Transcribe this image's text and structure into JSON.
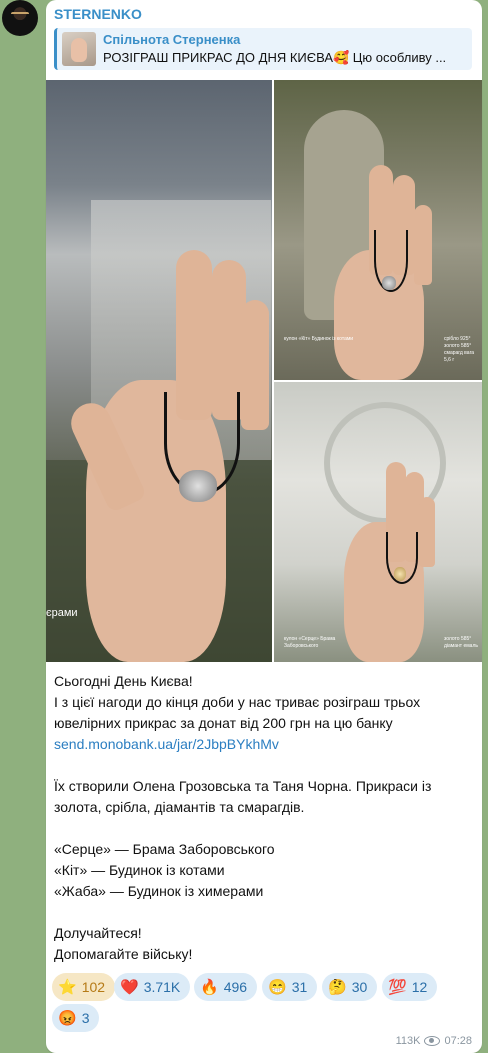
{
  "channel": {
    "name": "STERNENKO"
  },
  "reply": {
    "author": "Спільнота Стерненка",
    "preview": "РОЗІГРАШ ПРИКРАС ДО ДНЯ КИЄВА🥰 Цю особливу ..."
  },
  "photos": {
    "p1_caption": "єрами",
    "p2_caption_left": "кулон «Кіт» Будинок із котами",
    "p2_caption_right": "срібло 925° золото 585° смарагд вага 5,6 г",
    "p3_caption_left": "кулон «Серце» Брама Заборовського",
    "p3_caption_right": "золото 585° діамант емаль"
  },
  "message": {
    "line1": "Сьогодні День Києва!",
    "line2": "І з цієї нагоди до кінця доби у нас триває розіграш трьох ювелірних прикрас за донат від 200 грн на цю банку",
    "link": "send.monobank.ua/jar/2JbpBYkhMv",
    "line3": "Їх створили Олена Грозовська та Таня Чорна. Прикраси із золота, срібла, діамантів та смарагдів.",
    "item1": "«Серце» — Брама Заборовського",
    "item2": "«Кіт» — Будинок із котами",
    "item3": "«Жаба» — Будинок із химерами",
    "closing1": "Долучайтеся!",
    "closing2": "Допомагайте війську!"
  },
  "reactions": [
    {
      "emoji": "⭐",
      "count": "102"
    },
    {
      "emoji": "❤️",
      "count": "3.71K"
    },
    {
      "emoji": "🔥",
      "count": "496"
    },
    {
      "emoji": "😁",
      "count": "31"
    },
    {
      "emoji": "🤔",
      "count": "30"
    },
    {
      "emoji": "💯",
      "count": "12"
    },
    {
      "emoji": "😡",
      "count": "3"
    }
  ],
  "meta": {
    "views": "113K",
    "time": "07:28"
  }
}
